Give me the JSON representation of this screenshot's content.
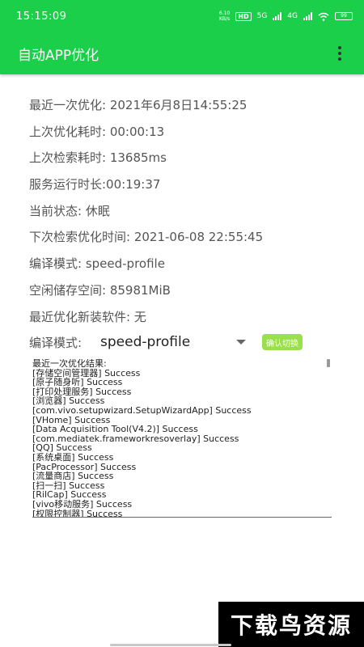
{
  "status": {
    "time": "15:15:09",
    "net_speed": [
      "6.10",
      "KB/s"
    ],
    "hd": "HD",
    "net1": "5G",
    "net2": "4G",
    "battery": "99"
  },
  "appbar": {
    "title": "自动APP优化"
  },
  "info": [
    "最近一次优化: 2021年6月8日14:55:25",
    "上次优化耗时: 00:00:13",
    "上次检索耗时: 13685ms",
    "服务运行时长:00:19:37",
    "当前状态: 休眠",
    "下次检索优化时间: 2021-06-08 22:55:45",
    "编译模式: speed-profile",
    "空闲储存空间: 85981MiB",
    "最近优化新装软件: 无"
  ],
  "mode": {
    "label": "编译模式:",
    "selected": "speed-profile",
    "confirm_label": "确认切换"
  },
  "result": {
    "lines": [
      "最近一次优化结果:",
      "[存储空间管理器]  Success",
      "[原子随身听]  Success",
      "[打印处理服务]  Success",
      "[浏览器]  Success",
      "[com.vivo.setupwizard.SetupWizardApp]  Success",
      "[VHome]  Success",
      "[Data Acquisition Tool(V4.2)]  Success",
      "[com.mediatek.frameworkresoverlay]  Success",
      "[QQ]  Success",
      "[系统桌面]  Success",
      "[PacProcessor]  Success",
      "[流量商店]  Success",
      "[扫一扫]  Success",
      "[RilCap]  Success",
      "[vivo移动服务]  Success",
      "[权限控制器]  Success"
    ]
  },
  "watermark": "下载鸟资源"
}
